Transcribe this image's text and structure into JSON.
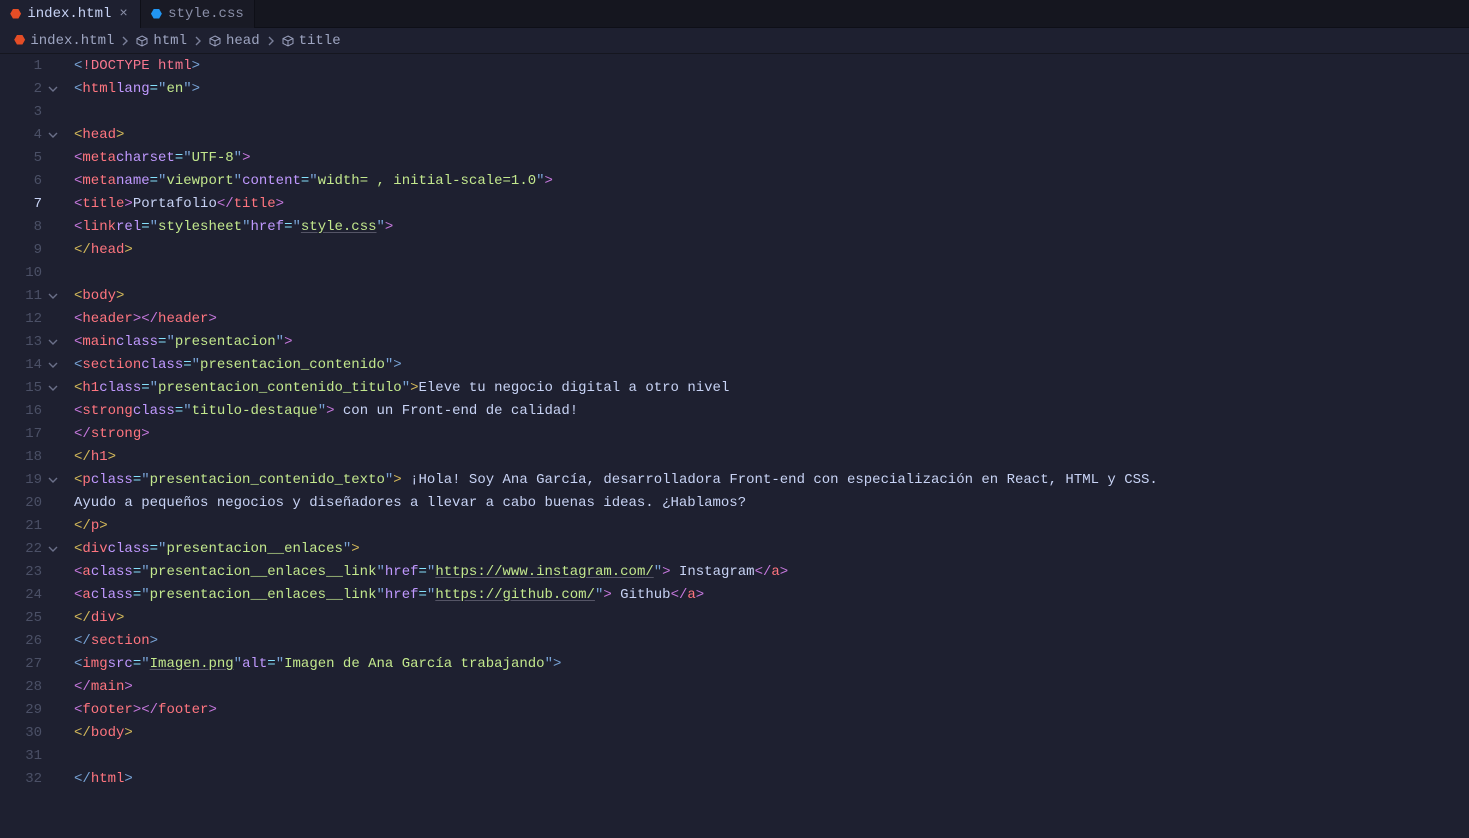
{
  "tabs": [
    {
      "label": "index.html",
      "type": "html",
      "active": true
    },
    {
      "label": "style.css",
      "type": "css",
      "active": false
    }
  ],
  "breadcrumb": [
    {
      "label": "index.html",
      "icon": "html5"
    },
    {
      "label": "html",
      "icon": "cube"
    },
    {
      "label": "head",
      "icon": "cube"
    },
    {
      "label": "title",
      "icon": "cube"
    }
  ],
  "lines": {
    "count": 32,
    "currentLine": 7,
    "foldable": [
      2,
      4,
      11,
      13,
      14,
      15,
      19,
      22
    ]
  },
  "code": {
    "l1": {
      "doctype": "DOCTYPE html"
    },
    "l2": {
      "tag": "html",
      "attr": "lang",
      "val": "en"
    },
    "l4": {
      "tag": "head"
    },
    "l5": {
      "tag": "meta",
      "attr": "charset",
      "val": "UTF-8"
    },
    "l6": {
      "tag": "meta",
      "a1": "name",
      "v1": "viewport",
      "a2": "content",
      "v2": "width= , initial-scale=1.0"
    },
    "l7": {
      "tag": "title",
      "text": "Portafolio"
    },
    "l8": {
      "tag": "link",
      "a1": "rel",
      "v1": "stylesheet",
      "a2": "href",
      "v2": "style.css"
    },
    "l9": {
      "tag": "head"
    },
    "l11": {
      "tag": "body"
    },
    "l12": {
      "tag": "header"
    },
    "l13": {
      "tag": "main",
      "attr": "class",
      "val": "presentacion"
    },
    "l14": {
      "tag": "section",
      "attr": "class",
      "val": "presentacion_contenido"
    },
    "l15": {
      "tag": "h1",
      "attr": "class",
      "val": "presentacion_contenido_titulo",
      "text": "Eleve tu negocio digital a otro nivel "
    },
    "l16": {
      "tag": "strong",
      "attr": "class",
      "val": "titulo-destaque",
      "text": " con un Front-end de calidad!"
    },
    "l17": {
      "tag": "strong"
    },
    "l18": {
      "tag": "h1"
    },
    "l19": {
      "tag": "p",
      "attr": "class",
      "val": "presentacion_contenido_texto",
      "text": " ¡Hola! Soy Ana García, desarrolladora Front-end con especialización en React, HTML y CSS. "
    },
    "l20": {
      "text": "Ayudo a pequeños negocios y diseñadores a llevar a cabo buenas ideas. ¿Hablamos?"
    },
    "l21": {
      "tag": "p"
    },
    "l22": {
      "tag": "div",
      "attr": "class",
      "val": "presentacion__enlaces"
    },
    "l23": {
      "tag": "a",
      "a1": "class",
      "v1": "presentacion__enlaces__link",
      "a2": "href",
      "v2": "https://www.instagram.com/",
      "text": " Instagram"
    },
    "l24": {
      "tag": "a",
      "a1": "class",
      "v1": "presentacion__enlaces__link",
      "a2": "href",
      "v2": "https://github.com/",
      "text": " Github"
    },
    "l25": {
      "tag": "div"
    },
    "l26": {
      "tag": "section"
    },
    "l27": {
      "tag": "img",
      "a1": "src",
      "v1": "Imagen.png",
      "a2": "alt",
      "v2": "Imagen de Ana García trabajando"
    },
    "l28": {
      "tag": "main"
    },
    "l29": {
      "tag": "footer"
    },
    "l30": {
      "tag": "body"
    },
    "l32": {
      "tag": "html"
    }
  }
}
